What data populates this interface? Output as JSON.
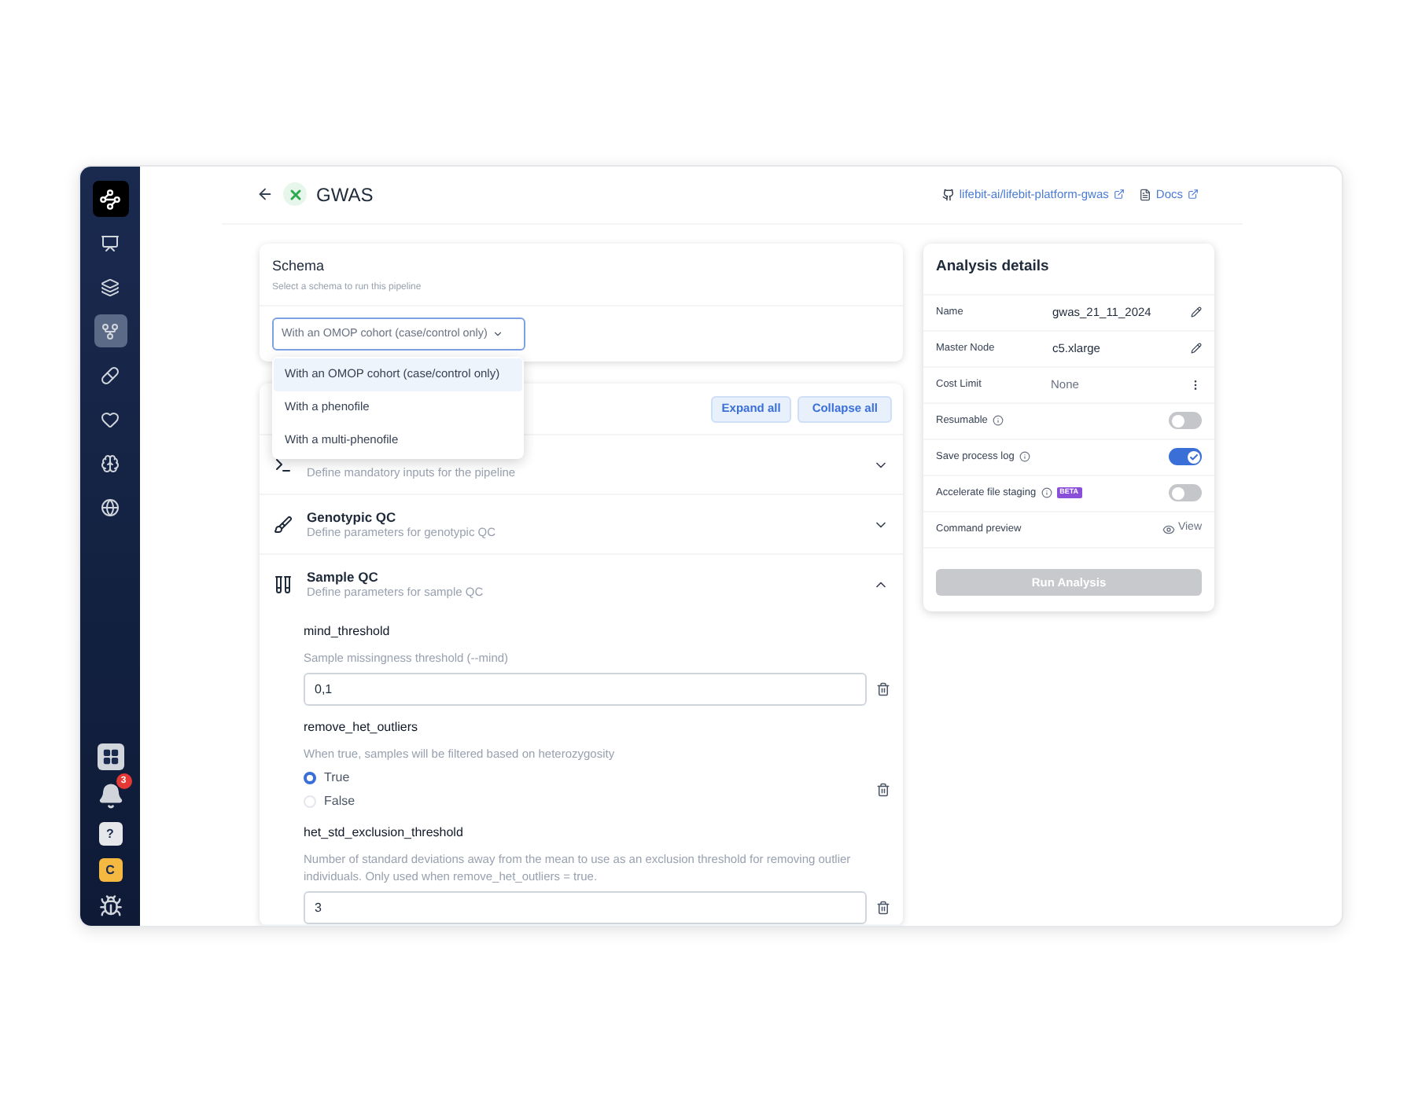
{
  "sidebar": {
    "items": [
      {
        "selected": false
      },
      {
        "selected": false
      },
      {
        "selected": true
      },
      {
        "selected": false
      },
      {
        "selected": false
      },
      {
        "selected": false
      },
      {
        "selected": false
      }
    ],
    "notification_count": "3",
    "help_label": "?",
    "user_initial": "C"
  },
  "header": {
    "title": "GWAS",
    "repo_link": "lifebit-ai/lifebit-platform-gwas",
    "docs_link": "Docs"
  },
  "schema": {
    "title": "Schema",
    "subtitle": "Select a schema to run this pipeline",
    "placeholder": "With an OMOP cohort (case/control only)",
    "options": [
      {
        "label": "With an OMOP cohort (case/control only)",
        "selected": true
      },
      {
        "label": "With a phenofile",
        "selected": false
      },
      {
        "label": "With a multi-phenofile",
        "selected": false
      }
    ]
  },
  "parameters": {
    "expand_button": "Expand all",
    "collapse_button": "Collapse all",
    "sections": [
      {
        "kind": "terminal",
        "subtitle": "Define mandatory inputs for the pipeline",
        "expanded": false
      },
      {
        "kind": "brush",
        "title": "Genotypic QC",
        "subtitle": "Define parameters for genotypic QC",
        "expanded": false
      },
      {
        "kind": "tubes",
        "title": "Sample QC",
        "subtitle": "Define parameters for sample QC",
        "expanded": true,
        "fields": [
          {
            "kind": "text",
            "name": "mind_threshold",
            "description": "Sample missingness threshold (--mind)",
            "value": "0,1"
          },
          {
            "kind": "radio",
            "name": "remove_het_outliers",
            "description": "When true, samples will be filtered based on heterozygosity",
            "options": [
              {
                "label": "True",
                "selected": true
              },
              {
                "label": "False",
                "selected": false
              }
            ]
          },
          {
            "kind": "text",
            "name": "het_std_exclusion_threshold",
            "description": "Number of standard deviations away from the mean to use as an exclusion threshold for removing outlier individuals. Only used when remove_het_outliers = true.",
            "value": "3"
          }
        ]
      }
    ]
  },
  "analysis": {
    "title": "Analysis details",
    "rows": [
      {
        "kind": "edit",
        "label": "Name",
        "value": "gwas_21_11_2024"
      },
      {
        "kind": "edit",
        "label": "Master Node",
        "value": "c5.xlarge"
      },
      {
        "kind": "menu",
        "label": "Cost Limit",
        "value": "None"
      },
      {
        "kind": "toggle",
        "label": "Resumable",
        "on": false
      },
      {
        "kind": "toggle",
        "label": "Save process log",
        "on": true
      },
      {
        "kind": "toggle",
        "label": "Accelerate file staging",
        "on": false,
        "badge": "BETA"
      },
      {
        "kind": "view",
        "label": "Command preview",
        "value": "View"
      }
    ],
    "run_button": {
      "label": "Run Analysis",
      "disabled": true
    }
  }
}
